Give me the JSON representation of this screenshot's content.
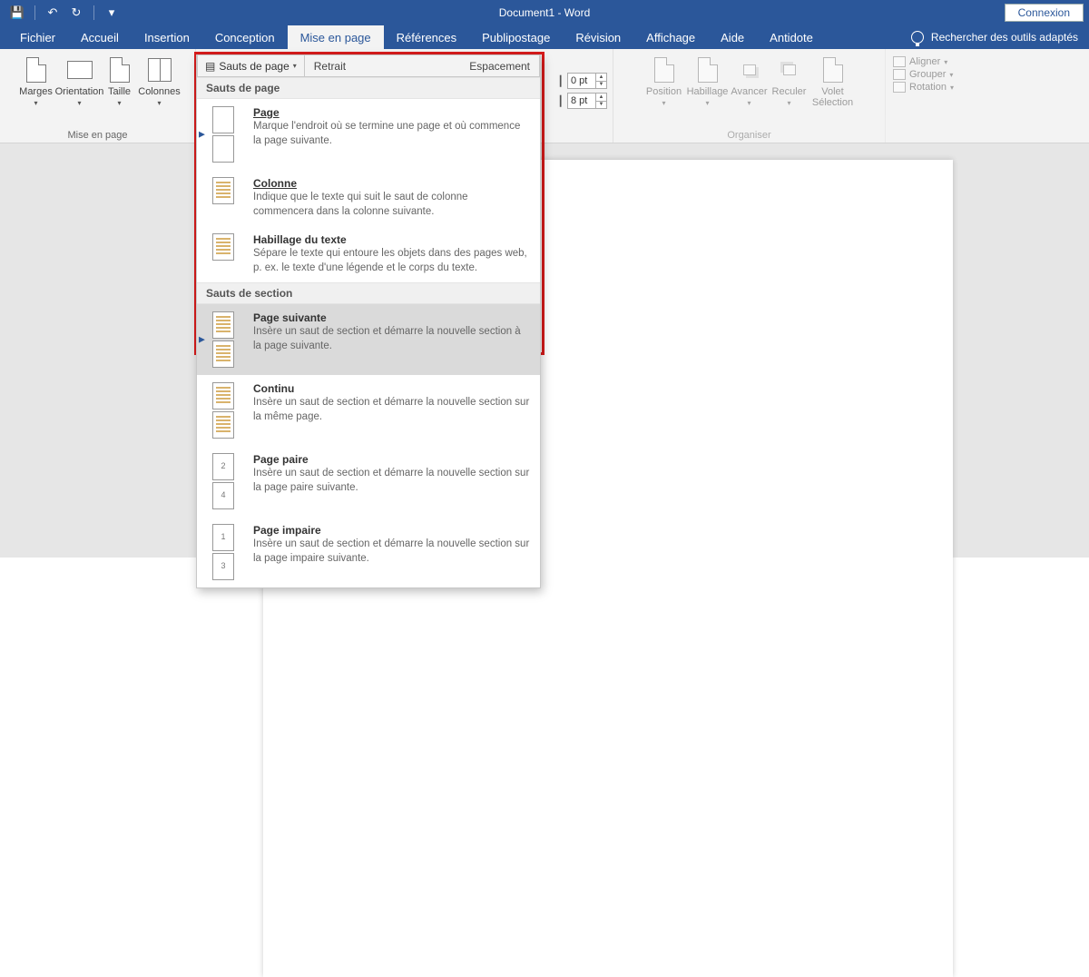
{
  "app": {
    "title": "Document1  -  Word",
    "signin": "Connexion"
  },
  "qat": {
    "save": "💾",
    "undo": "↶",
    "redo": "↻",
    "custom": "▾"
  },
  "tabs": [
    "Fichier",
    "Accueil",
    "Insertion",
    "Conception",
    "Mise en page",
    "Références",
    "Publipostage",
    "Révision",
    "Affichage",
    "Aide",
    "Antidote"
  ],
  "active_tab": 4,
  "tellme": "Rechercher des outils adaptés",
  "ribbon": {
    "page_setup": {
      "label": "Mise en page",
      "marges": "Marges",
      "orientation": "Orientation",
      "taille": "Taille",
      "colonnes": "Colonnes"
    },
    "breaks_button": "Sauts de page",
    "retrait": "Retrait",
    "espacement": "Espacement",
    "spacing": {
      "before": "0 pt",
      "after": "8 pt"
    },
    "arrange": {
      "label": "Organiser",
      "position": "Position",
      "habillage": "Habillage",
      "avancer": "Avancer",
      "reculer": "Reculer",
      "volet": "Volet Sélection",
      "aligner": "Aligner",
      "grouper": "Grouper",
      "rotation": "Rotation"
    }
  },
  "menu": {
    "section1": "Sauts de page",
    "section2": "Sauts de section",
    "items1": [
      {
        "title": "Page",
        "desc": "Marque l'endroit où se termine une page et où commence la page suivante."
      },
      {
        "title": "Colonne",
        "desc": "Indique que le texte qui suit le saut de colonne commencera dans la colonne suivante."
      },
      {
        "title": "Habillage du texte",
        "desc": "Sépare le texte qui entoure les objets dans des pages web, p. ex. le texte d'une légende et le corps du texte."
      }
    ],
    "items2": [
      {
        "title": "Page suivante",
        "desc": "Insère un saut de section et démarre la nouvelle section à la page suivante."
      },
      {
        "title": "Continu",
        "desc": "Insère un saut de section et démarre la nouvelle section sur la même page."
      },
      {
        "title": "Page paire",
        "desc": "Insère un saut de section et démarre la nouvelle section sur la page paire suivante."
      },
      {
        "title": "Page impaire",
        "desc": "Insère un saut de section et démarre la nouvelle section sur la page impaire suivante."
      }
    ]
  }
}
